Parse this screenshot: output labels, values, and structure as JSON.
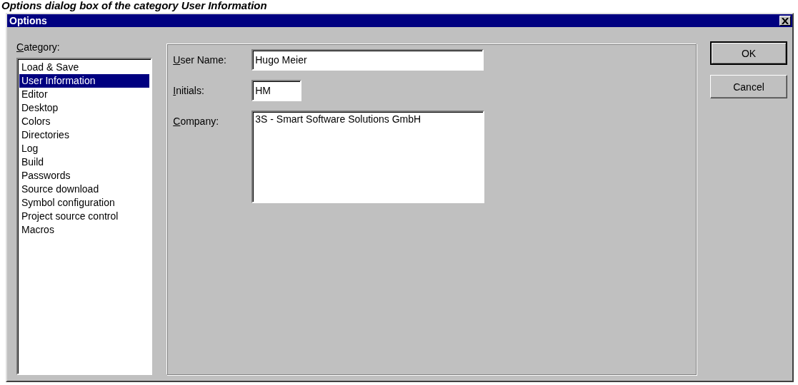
{
  "caption": "Options dialog box of the category User Information",
  "window": {
    "title": "Options"
  },
  "category": {
    "label": "Category:",
    "items": [
      {
        "label": "Load & Save",
        "selected": false
      },
      {
        "label": "User Information",
        "selected": true
      },
      {
        "label": "Editor",
        "selected": false
      },
      {
        "label": "Desktop",
        "selected": false
      },
      {
        "label": "Colors",
        "selected": false
      },
      {
        "label": "Directories",
        "selected": false
      },
      {
        "label": "Log",
        "selected": false
      },
      {
        "label": "Build",
        "selected": false
      },
      {
        "label": "Passwords",
        "selected": false
      },
      {
        "label": "Source download",
        "selected": false
      },
      {
        "label": "Symbol configuration",
        "selected": false
      },
      {
        "label": "Project source control",
        "selected": false
      },
      {
        "label": "Macros",
        "selected": false
      }
    ]
  },
  "fields": [
    {
      "kind": "line",
      "label": "User Name:",
      "value": "Hugo Meier"
    },
    {
      "kind": "short",
      "label": "Initials:",
      "value": "HM"
    },
    {
      "kind": "multiline",
      "label": "Company:",
      "value": "3S - Smart Software Solutions GmbH"
    }
  ],
  "buttons": [
    {
      "label": "OK",
      "default": true
    },
    {
      "label": "Cancel",
      "default": false
    }
  ]
}
